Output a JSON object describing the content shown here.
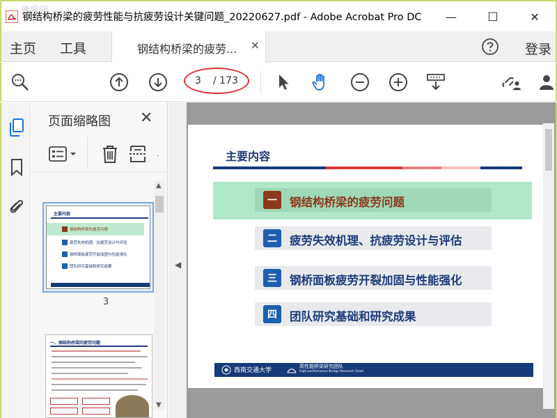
{
  "window": {
    "title": "钢结构桥梁的疲劳性能与抗疲劳设计关键问题_20220627.pdf - Adobe Acrobat Pro DC",
    "watermark": "速报网",
    "minimize": "—",
    "maximize": "☐",
    "close": "✕"
  },
  "nav": {
    "home": "主页",
    "tools": "工具",
    "doc_tab": "钢结构桥梁的疲劳...",
    "doc_tab_close": "×",
    "login": "登录"
  },
  "toolbar": {
    "page_current": "3",
    "page_total": "/ 173"
  },
  "thumbnails": {
    "title": "页面缩略图",
    "close": "✕",
    "page_label": "3",
    "thumb1_heading": "主要内容",
    "thumb1_items": [
      "钢结构桥梁的疲劳问题",
      "疲劳失效机理、抗疲劳设计与评估",
      "钢桥面板疲劳开裂加固与性能强化",
      "团队研究基础和研究成果"
    ],
    "thumb2_heading": "一、钢结构桥梁的疲劳问题"
  },
  "slide": {
    "heading": "主要内容",
    "items": [
      {
        "num": "一",
        "text": "钢结构桥梁的疲劳问题",
        "num_color": "#8a3a1e",
        "text_color": "#8a3a1e",
        "highlight": true
      },
      {
        "num": "二",
        "text": "疲劳失效机理、抗疲劳设计与评估",
        "num_color": "#1f5fb0",
        "text_color": "#1f3b7a",
        "highlight": false
      },
      {
        "num": "三",
        "text": "钢桥面板疲劳开裂加固与性能强化",
        "num_color": "#1f5fb0",
        "text_color": "#1f3b7a",
        "highlight": false
      },
      {
        "num": "四",
        "text": "团队研究基础和研究成果",
        "num_color": "#1f5fb0",
        "text_color": "#1f3b7a",
        "highlight": false
      }
    ],
    "footer_left": "西南交通大学",
    "footer_right": "高性能桥梁研究团队",
    "footer_right_en": "High-performance Bridge Research Team"
  },
  "colors": {
    "accent_red": "#e03030",
    "navy": "#163a7a",
    "highlight_green": "#aee8c9"
  }
}
